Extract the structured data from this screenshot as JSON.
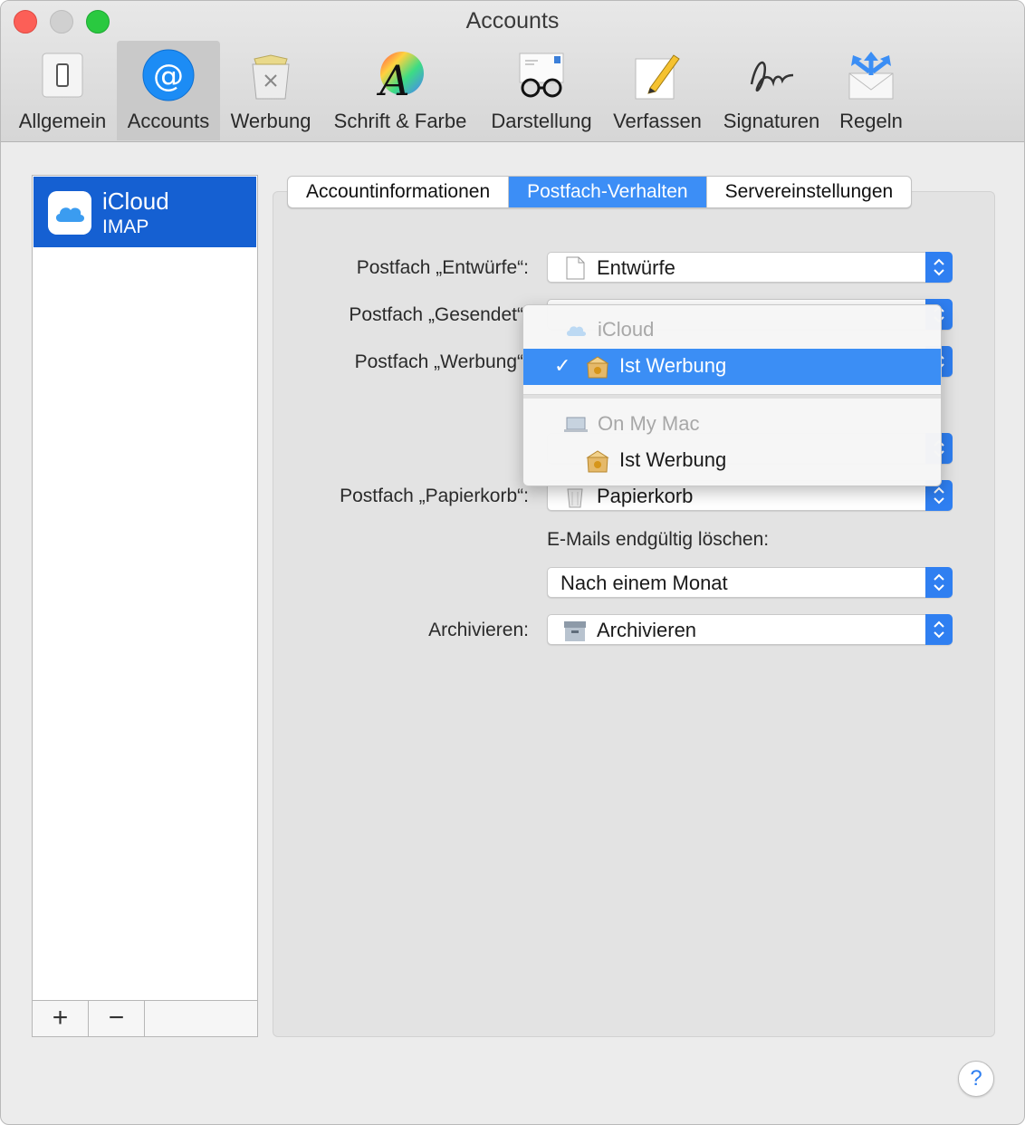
{
  "window": {
    "title": "Accounts"
  },
  "toolbar": {
    "items": [
      {
        "label": "Allgemein",
        "icon": "switch-icon"
      },
      {
        "label": "Accounts",
        "icon": "at-sign-icon"
      },
      {
        "label": "Werbung",
        "icon": "junk-bin-icon"
      },
      {
        "label": "Schrift & Farbe",
        "icon": "font-color-icon"
      },
      {
        "label": "Darstellung",
        "icon": "glasses-icon"
      },
      {
        "label": "Verfassen",
        "icon": "pencil-note-icon"
      },
      {
        "label": "Signaturen",
        "icon": "signature-icon"
      },
      {
        "label": "Regeln",
        "icon": "rules-envelope-icon"
      }
    ],
    "active": "Accounts"
  },
  "sidebar": {
    "account": {
      "name": "iCloud",
      "type": "IMAP",
      "icon": "icloud-icon"
    },
    "add_label": "+",
    "remove_label": "−"
  },
  "tabs": [
    {
      "label": "Accountinformationen"
    },
    {
      "label": "Postfach-Verhalten"
    },
    {
      "label": "Servereinstellungen"
    }
  ],
  "form": {
    "drafts": {
      "label": "Postfach „Entwürfe“:",
      "value": "Entwürfe",
      "icon": "document-icon"
    },
    "sent": {
      "label": "Postfach „Gesendet“"
    },
    "junk": {
      "label": "Postfach „Werbung“"
    },
    "trash": {
      "label": "Postfach „Papierkorb“:",
      "value": "Papierkorb",
      "icon": "trash-icon"
    },
    "erase_heading": "E-Mails endgültig löschen:",
    "erase": {
      "value": "Nach einem Monat"
    },
    "archive": {
      "label": "Archivieren:",
      "value": "Archivieren",
      "icon": "archive-box-icon"
    }
  },
  "popup": {
    "group1": {
      "header": "iCloud",
      "item": "Ist Werbung",
      "checked": true
    },
    "group2": {
      "header": "On My Mac",
      "item": "Ist Werbung"
    }
  },
  "help": {
    "label": "?"
  },
  "colors": {
    "accent": "#3b8ef5",
    "selection": "#1560d2"
  }
}
